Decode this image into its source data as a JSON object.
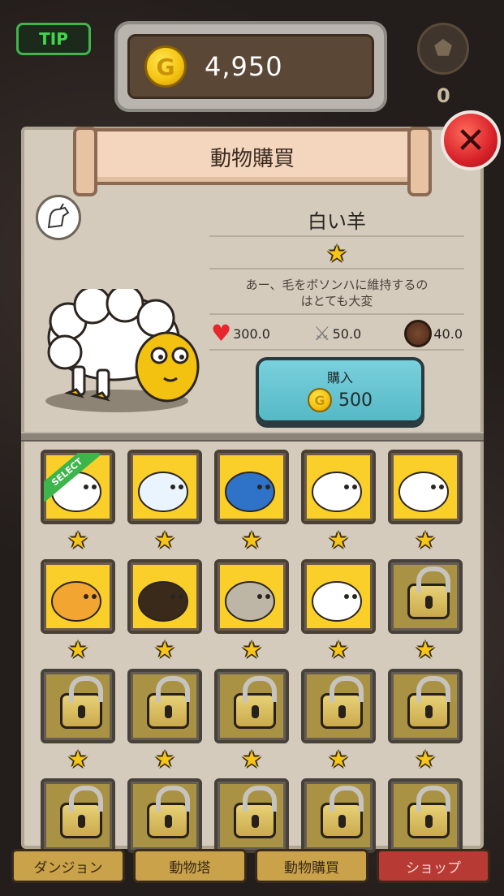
{
  "top_bar": {
    "tip_label": "TIP",
    "coin_symbol": "G",
    "coin_amount": "4,950",
    "rank_count": "0"
  },
  "panel": {
    "title": "動物購買",
    "close_symbol": "✕"
  },
  "selected_animal": {
    "name": "白い羊",
    "rarity_stars": 1,
    "star_glyph": "★",
    "description_line1": "あー、毛をボソンハに維持するの",
    "description_line2": "はとても大変",
    "hp": "300.0",
    "attack": "50.0",
    "defense": "40.0"
  },
  "buy_button": {
    "label": "購入",
    "coin_symbol": "G",
    "price": "500"
  },
  "animal_grid": [
    {
      "animal": "sheep",
      "stars": 1,
      "locked": false,
      "selected": true
    },
    {
      "animal": "elephant",
      "stars": 1,
      "locked": false,
      "selected": false
    },
    {
      "animal": "lion",
      "stars": 1,
      "locked": false,
      "selected": false
    },
    {
      "animal": "wolf",
      "stars": 1,
      "locked": false,
      "selected": false
    },
    {
      "animal": "crane",
      "stars": 1,
      "locked": false,
      "selected": false
    },
    {
      "animal": "shiba-dog",
      "stars": 1,
      "locked": false,
      "selected": false
    },
    {
      "animal": "eagle",
      "stars": 1,
      "locked": false,
      "selected": false
    },
    {
      "animal": "sloth",
      "stars": 1,
      "locked": false,
      "selected": false
    },
    {
      "animal": "white-sheep",
      "stars": 1,
      "locked": false,
      "selected": false
    },
    {
      "animal": "locked",
      "stars": 1,
      "locked": true,
      "selected": false
    },
    {
      "animal": "locked",
      "stars": 1,
      "locked": true,
      "selected": false
    },
    {
      "animal": "locked",
      "stars": 1,
      "locked": true,
      "selected": false
    },
    {
      "animal": "locked",
      "stars": 1,
      "locked": true,
      "selected": false
    },
    {
      "animal": "locked",
      "stars": 1,
      "locked": true,
      "selected": false
    },
    {
      "animal": "locked",
      "stars": 1,
      "locked": true,
      "selected": false
    },
    {
      "animal": "locked",
      "stars": 0,
      "locked": true,
      "selected": false
    },
    {
      "animal": "locked",
      "stars": 0,
      "locked": true,
      "selected": false
    },
    {
      "animal": "locked",
      "stars": 0,
      "locked": true,
      "selected": false
    },
    {
      "animal": "locked",
      "stars": 0,
      "locked": true,
      "selected": false
    },
    {
      "animal": "locked",
      "stars": 0,
      "locked": true,
      "selected": false
    }
  ],
  "select_ribbon_label": "SELECT",
  "tabs": [
    {
      "label": "ダンジョン"
    },
    {
      "label": "動物塔"
    },
    {
      "label": "動物購買"
    },
    {
      "label": "ショップ"
    }
  ],
  "colors": {
    "tile_yellow": "#fbcf2a",
    "buy_button": "#6cc7d3",
    "close_red": "#d8222a",
    "tip_green": "#3fd84d",
    "shop_tab": "#b83a35"
  }
}
